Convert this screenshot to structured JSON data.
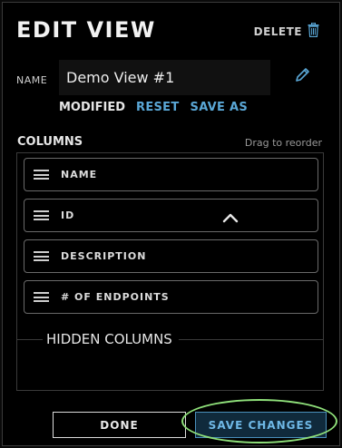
{
  "header": {
    "title": "EDIT VIEW",
    "delete_label": "DELETE",
    "delete_icon": "trash-icon"
  },
  "name_field": {
    "label": "NAME",
    "value": "Demo View #1",
    "edit_icon": "pencil-icon"
  },
  "status": {
    "modified_label": "MODIFIED",
    "reset_label": "RESET",
    "save_as_label": "SAVE AS"
  },
  "columns": {
    "label": "COLUMNS",
    "drag_hint": "Drag to reorder",
    "items": [
      {
        "label": "NAME"
      },
      {
        "label": "ID"
      },
      {
        "label": "DESCRIPTION"
      },
      {
        "label": "# OF ENDPOINTS"
      }
    ]
  },
  "hidden_columns": {
    "label": "HIDDEN COLUMNS"
  },
  "footer": {
    "done_label": "DONE",
    "save_changes_label": "SAVE CHANGES"
  },
  "colors": {
    "accent": "#5aa7d6",
    "highlight": "#8fe07a",
    "background": "#000000"
  }
}
